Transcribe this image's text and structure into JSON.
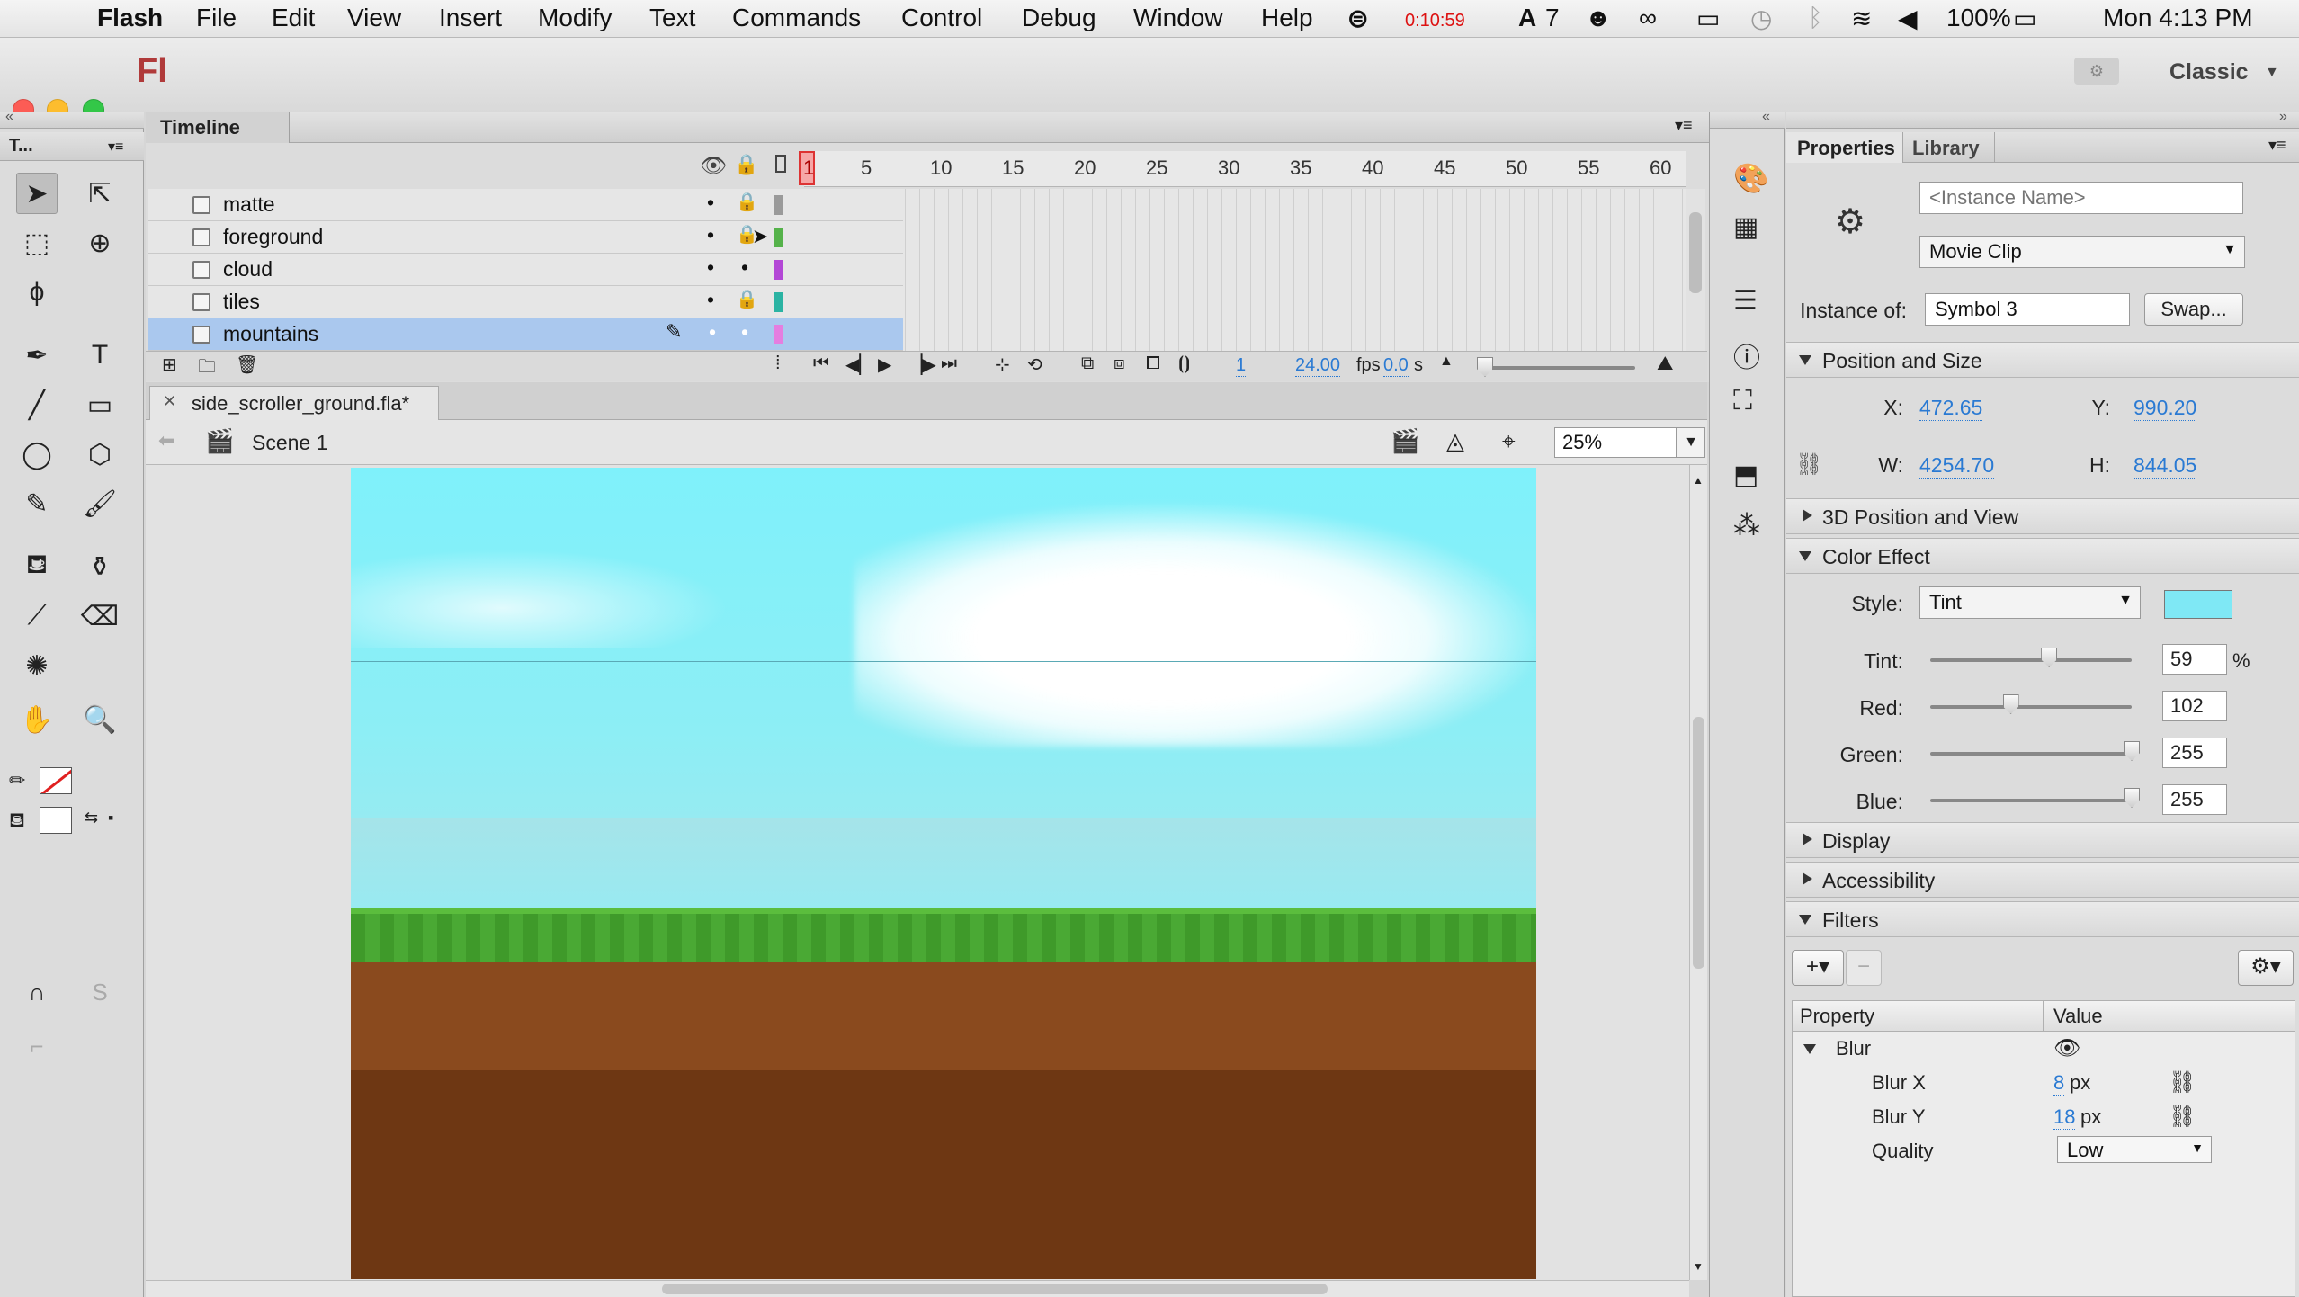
{
  "menubar": {
    "app": "Flash",
    "items": [
      "File",
      "Edit",
      "View",
      "Insert",
      "Modify",
      "Text",
      "Commands",
      "Control",
      "Debug",
      "Window",
      "Help"
    ],
    "recording_time": "0:10:59",
    "adobe_count": "7",
    "battery": "100%",
    "clock": "Mon 4:13 PM"
  },
  "titlebar": {
    "logo": "Fl",
    "workspace": "Classic"
  },
  "tools_panel": {
    "title": "T..."
  },
  "timeline": {
    "tab": "Timeline",
    "ruler": [
      "1",
      "5",
      "10",
      "15",
      "20",
      "25",
      "30",
      "35",
      "40",
      "45",
      "50",
      "55",
      "60"
    ],
    "layers": [
      {
        "name": "matte",
        "color": "#9a9a9a",
        "locked": true
      },
      {
        "name": "foreground",
        "color": "#55b24a",
        "locked": true
      },
      {
        "name": "cloud",
        "color": "#b347d6",
        "locked": false
      },
      {
        "name": "tiles",
        "color": "#2bb3a3",
        "locked": true
      },
      {
        "name": "mountains",
        "color": "#e57ee0",
        "locked": false,
        "selected": true
      }
    ],
    "status": {
      "frame": "1",
      "fps": "24.00",
      "fps_unit": "fps",
      "time": "0.0",
      "time_unit": "s"
    }
  },
  "document": {
    "tab": "side_scroller_ground.fla*",
    "scene": "Scene 1",
    "zoom": "25%"
  },
  "properties": {
    "tabs": [
      "Properties",
      "Library"
    ],
    "instance_name_placeholder": "<Instance Name>",
    "symbol_type": "Movie Clip",
    "instance_of_label": "Instance of:",
    "instance_of": "Symbol 3",
    "swap_label": "Swap...",
    "position_size": {
      "title": "Position and Size",
      "x_label": "X:",
      "x": "472.65",
      "y_label": "Y:",
      "y": "990.20",
      "w_label": "W:",
      "w": "4254.70",
      "h_label": "H:",
      "h": "844.05"
    },
    "position_3d": "3D Position and View",
    "color_effect": {
      "title": "Color Effect",
      "style_label": "Style:",
      "style": "Tint",
      "tint_color": "#7fe8f5",
      "tint_label": "Tint:",
      "tint": "59",
      "tint_unit": "%",
      "red_label": "Red:",
      "red": "102",
      "green_label": "Green:",
      "green": "255",
      "blue_label": "Blue:",
      "blue": "255"
    },
    "display": "Display",
    "accessibility": "Accessibility",
    "filters": {
      "title": "Filters",
      "col_property": "Property",
      "col_value": "Value",
      "filter_name": "Blur",
      "blur_x_label": "Blur X",
      "blur_x": "8",
      "blur_y_label": "Blur Y",
      "blur_y": "18",
      "unit": "px",
      "quality_label": "Quality",
      "quality": "Low"
    }
  }
}
